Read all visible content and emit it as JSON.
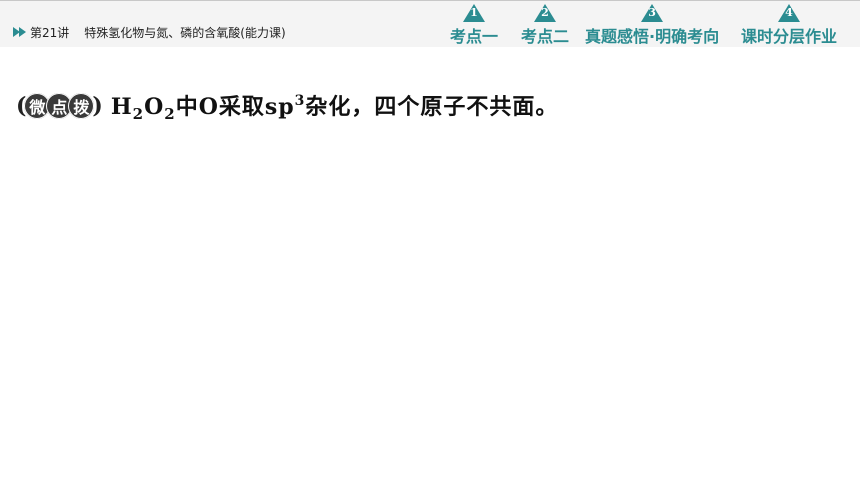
{
  "header": {
    "lesson_prefix": "第21讲",
    "lesson_title": "特殊氢化物与氮、磷的含氧酸(能力课)"
  },
  "nav": [
    {
      "number": "1",
      "label": "考点一"
    },
    {
      "number": "2",
      "label": "考点二"
    },
    {
      "number": "3",
      "label": "真题感悟·明确考向"
    },
    {
      "number": "4",
      "label": "课时分层作业"
    }
  ],
  "accent_color": "#2b8c91",
  "tip": {
    "badge_chars": [
      "微",
      "点",
      "拨"
    ],
    "formula_h": "H",
    "formula_h_sub": "2",
    "formula_o": "O",
    "formula_o_sub": "2",
    "text_part1": "中O采取sp",
    "superscript": "3",
    "text_part2": "杂化，四个原子不共面。"
  }
}
